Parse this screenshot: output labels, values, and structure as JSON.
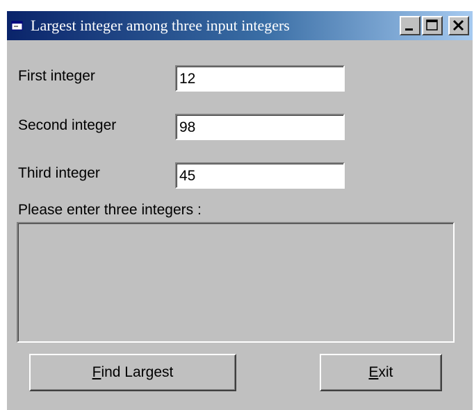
{
  "window": {
    "title": "Largest integer among three input integers"
  },
  "form": {
    "first_label": "First integer",
    "first_value": "12",
    "second_label": "Second integer",
    "second_value": "98",
    "third_label": "Third integer",
    "third_value": "45",
    "prompt": "Please enter three integers :",
    "output": ""
  },
  "buttons": {
    "find_mnemonic": "F",
    "find_rest": "ind Largest",
    "exit_mnemonic": "E",
    "exit_rest": "xit"
  },
  "icons": {
    "app": "app-window-icon",
    "minimize": "minimize-icon",
    "maximize": "maximize-icon",
    "close": "close-icon"
  }
}
